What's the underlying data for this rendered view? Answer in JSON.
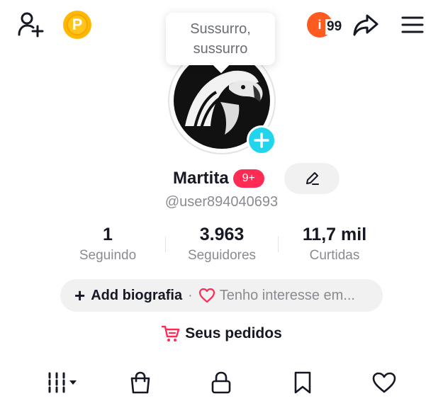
{
  "header": {
    "points_label": "P",
    "notification_avatar_letter": "i",
    "notification_count": "99"
  },
  "tooltip": {
    "line1": "Sussurro,",
    "line2": "sussurro"
  },
  "profile": {
    "username": "Martita",
    "badge": "9+",
    "handle": "@user894040693"
  },
  "stats": [
    {
      "value": "1",
      "label": "Seguindo"
    },
    {
      "value": "3.963",
      "label": "Seguidores"
    },
    {
      "value": "11,7 mil",
      "label": "Curtidas"
    }
  ],
  "bio": {
    "add_label": "Add biografia",
    "separator": "·",
    "interests_label": "Tenho interesse em..."
  },
  "orders": {
    "label": "Seus pedidos"
  },
  "tabs": [
    {
      "icon": "grid-videos-icon"
    },
    {
      "icon": "shopping-bag-icon"
    },
    {
      "icon": "lock-icon"
    },
    {
      "icon": "bookmark-icon"
    },
    {
      "icon": "heart-icon"
    }
  ],
  "colors": {
    "accent_red": "#fe2c55",
    "accent_cyan": "#20d5ec",
    "points_gold": "#ffb800",
    "notification_orange": "#ff5a1f"
  }
}
